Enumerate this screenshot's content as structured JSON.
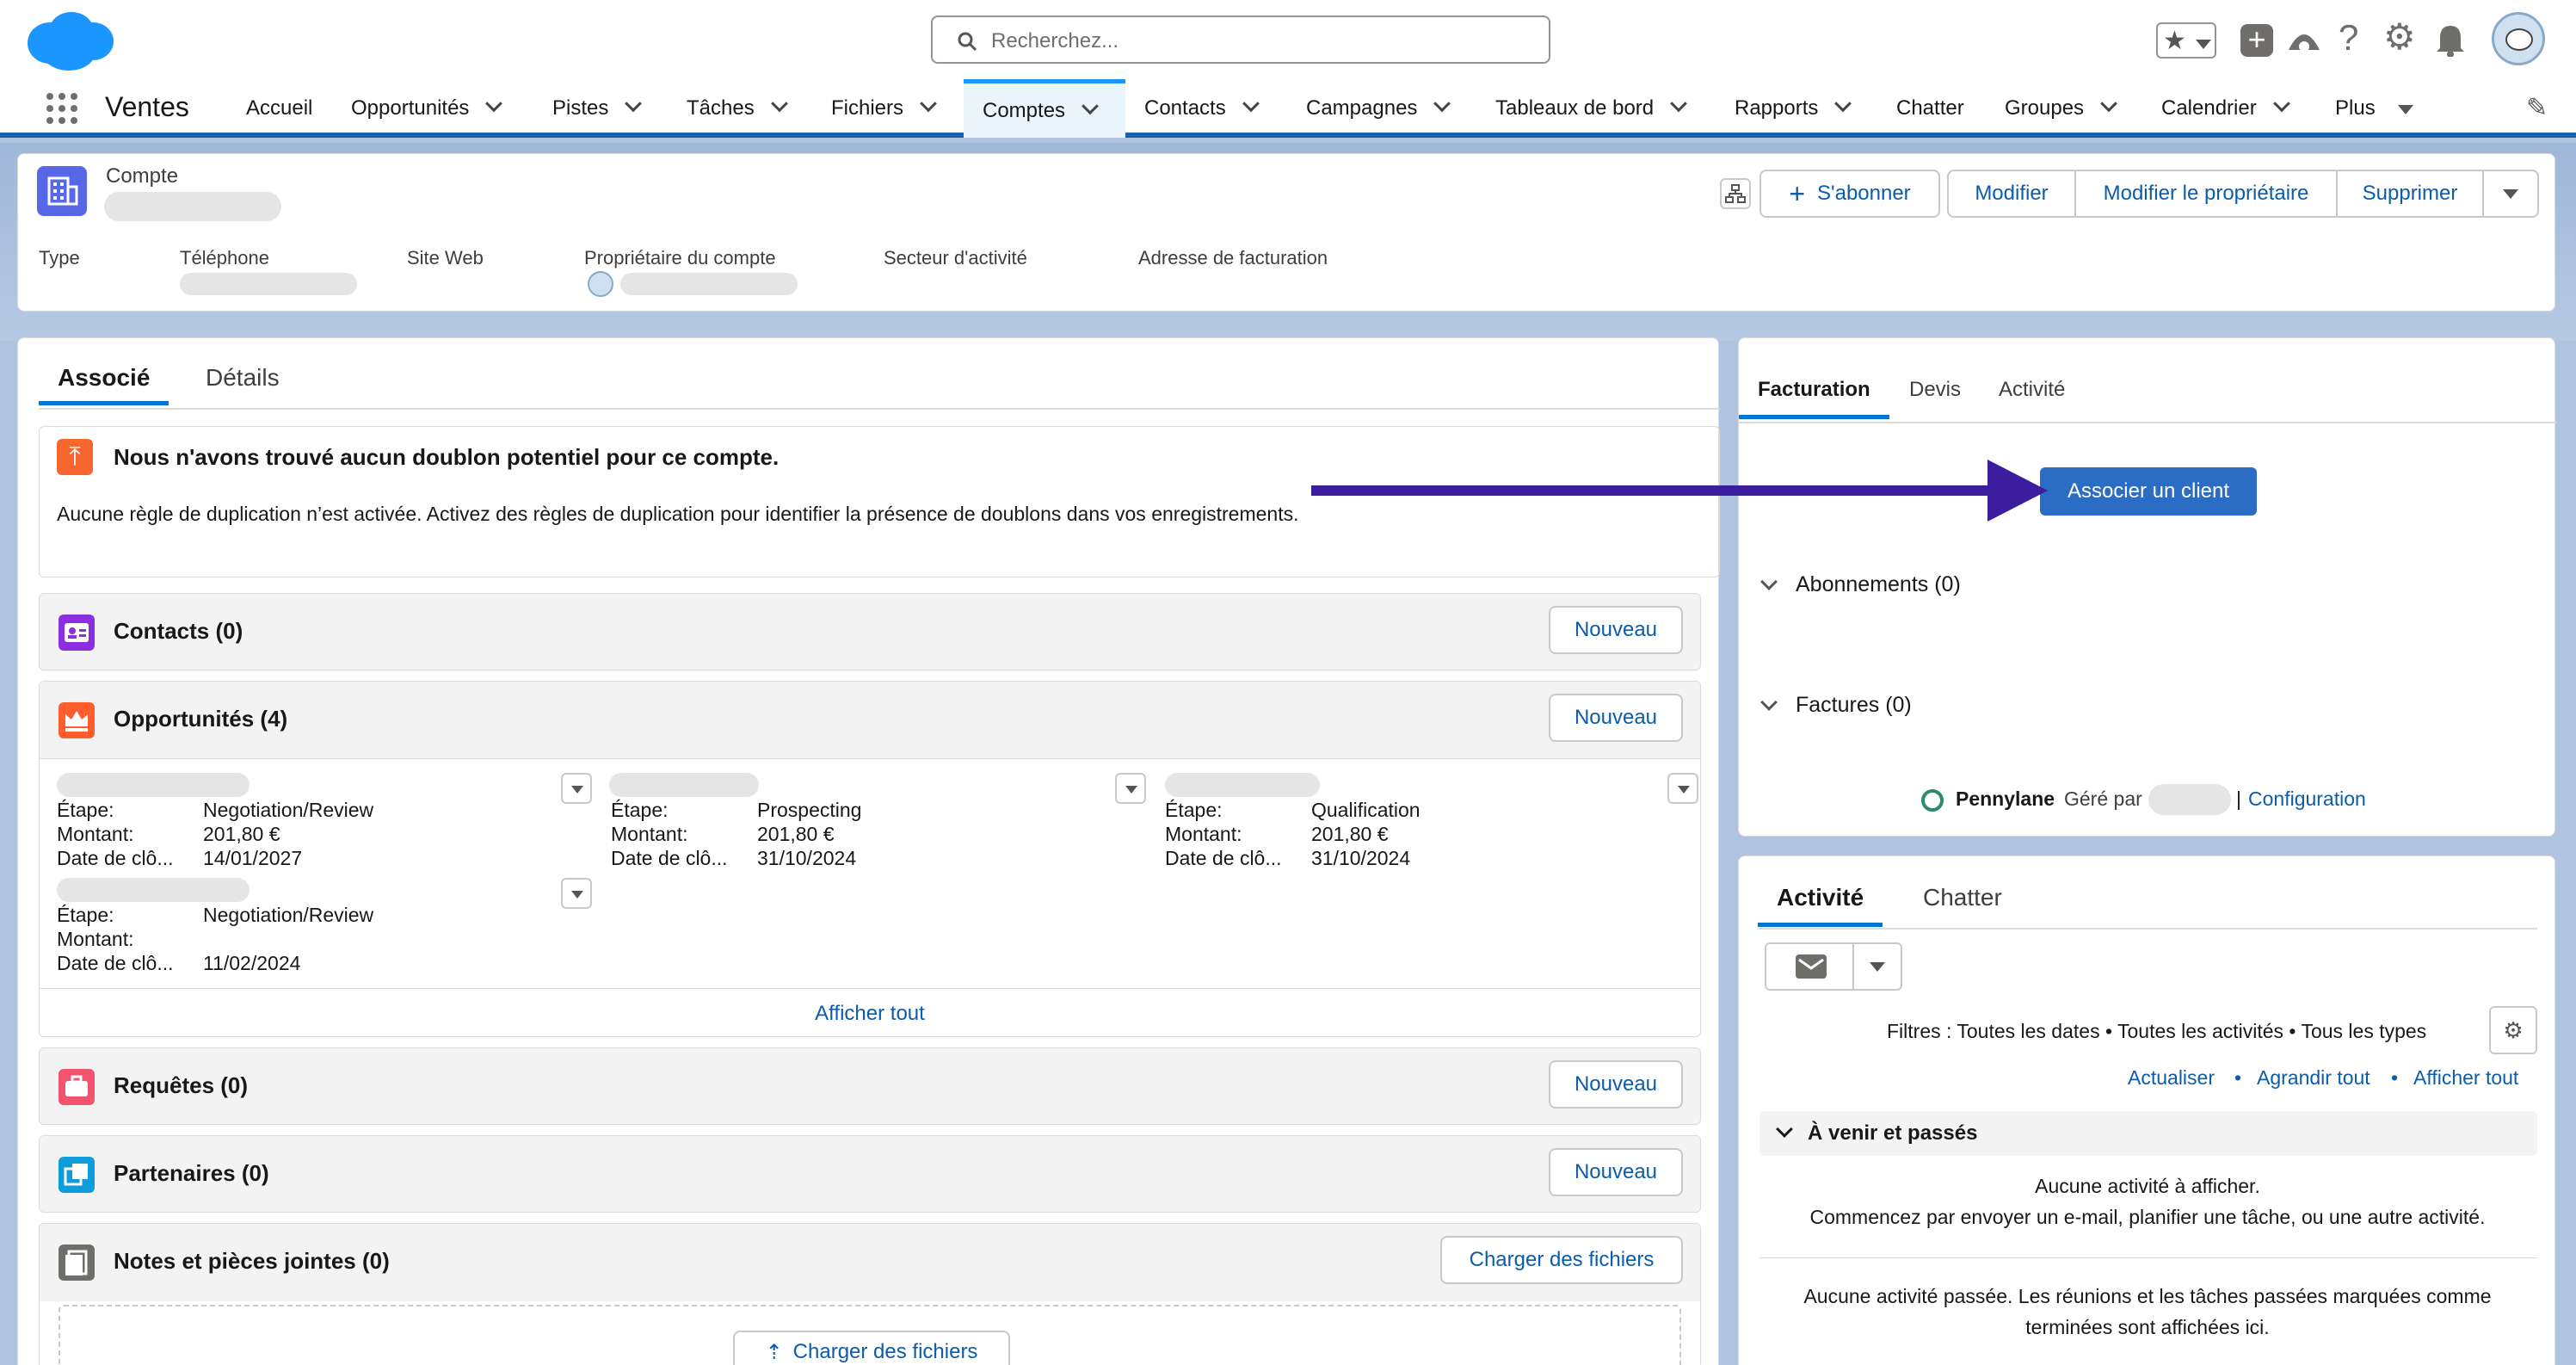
{
  "colors": {
    "brand": "#1b96ff",
    "link": "#0b5cab",
    "arrow": "#3c1d9e",
    "primary_button": "#2b6cc4"
  },
  "search": {
    "placeholder": "Recherchez..."
  },
  "app": {
    "name": "Ventes"
  },
  "nav": {
    "items": [
      {
        "label": "Accueil"
      },
      {
        "label": "Opportunités"
      },
      {
        "label": "Pistes"
      },
      {
        "label": "Tâches"
      },
      {
        "label": "Fichiers"
      },
      {
        "label": "Comptes"
      },
      {
        "label": "Contacts"
      },
      {
        "label": "Campagnes"
      },
      {
        "label": "Tableaux de bord"
      },
      {
        "label": "Rapports"
      },
      {
        "label": "Chatter"
      },
      {
        "label": "Groupes"
      },
      {
        "label": "Calendrier"
      },
      {
        "label": "Plus"
      }
    ]
  },
  "record": {
    "object_label": "Compte",
    "buttons": {
      "subscribe": "S'abonner",
      "edit": "Modifier",
      "change_owner": "Modifier le propriétaire",
      "delete": "Supprimer"
    },
    "fields": {
      "type": "Type",
      "phone": "Téléphone",
      "website": "Site Web",
      "owner": "Propriétaire du compte",
      "industry": "Secteur d'activité",
      "billing": "Adresse de facturation"
    }
  },
  "tabs": {
    "related": "Associé",
    "details": "Détails"
  },
  "duplicate": {
    "title": "Nous n'avons trouvé aucun doublon potentiel pour ce compte.",
    "body": "Aucune règle de duplication n’est activée. Activez des règles de duplication pour identifier la présence de doublons dans vos enregistrements."
  },
  "related": {
    "new_label": "Nouveau",
    "contacts": "Contacts (0)",
    "opportunities": "Opportunités (4)",
    "cases": "Requêtes (0)",
    "partners": "Partenaires (0)",
    "notes": "Notes et pièces jointes (0)",
    "upload": "Charger des fichiers",
    "view_all": "Afficher tout",
    "opp_labels": {
      "stage": "Étape:",
      "amount": "Montant:",
      "close": "Date de clô..."
    },
    "opps": [
      {
        "stage": "Negotiation/Review",
        "amount": "201,80 €",
        "close": "14/01/2027"
      },
      {
        "stage": "Prospecting",
        "amount": "201,80 €",
        "close": "31/10/2024"
      },
      {
        "stage": "Qualification",
        "amount": "201,80 €",
        "close": "31/10/2024"
      },
      {
        "stage": "Negotiation/Review",
        "amount": "",
        "close": "11/02/2024"
      }
    ]
  },
  "billing_panel": {
    "tabs": [
      "Facturation",
      "Devis",
      "Activité"
    ],
    "associate_button": "Associer un client",
    "subscriptions": "Abonnements (0)",
    "invoices": "Factures (0)",
    "brand": "Pennylane",
    "managed_by": "Géré par",
    "separator": "|",
    "config": "Configuration"
  },
  "activity_panel": {
    "tabs": [
      "Activité",
      "Chatter"
    ],
    "filters": "Filtres : Toutes les dates • Toutes les activités • Tous les types",
    "links": [
      "Actualiser",
      "Agrandir tout",
      "Afficher tout"
    ],
    "upcoming": "À venir et passés",
    "empty1": "Aucune activité à afficher.",
    "empty2": "Commencez par envoyer un e-mail, planifier une tâche, ou une autre activité.",
    "past1": "Aucune activité passée. Les réunions et les tâches passées marquées comme",
    "past2": "terminées sont affichées ici."
  }
}
